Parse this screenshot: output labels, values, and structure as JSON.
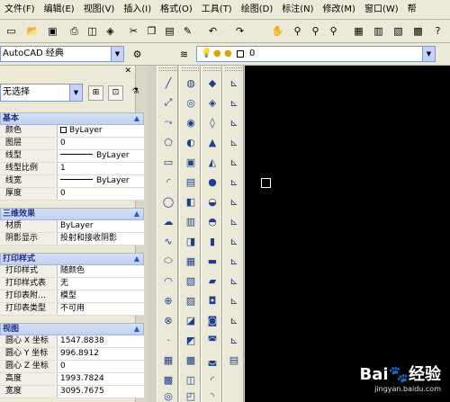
{
  "menu": {
    "items": [
      "文件(F)",
      "编辑(E)",
      "视图(V)",
      "插入(I)",
      "格式(O)",
      "工具(T)",
      "绘图(D)",
      "标注(N)",
      "修改(M)",
      "窗口(W)",
      "帮"
    ]
  },
  "toolbar": {
    "icons": [
      "new-icon",
      "open-icon",
      "save-icon",
      "plot-icon",
      "plot-preview-icon",
      "publish-icon",
      "cut-icon",
      "copy-icon",
      "paste-icon",
      "match-properties-icon",
      "undo-icon",
      "redo-icon",
      "pan-icon",
      "zoom-realtime-icon",
      "zoom-window-icon",
      "zoom-previous-icon",
      "properties-icon",
      "design-center-icon",
      "tool-palettes-icon",
      "calculator-icon"
    ]
  },
  "workspace": {
    "value": "AutoCAD 经典",
    "layer_value": "0"
  },
  "properties": {
    "selection": "无选择",
    "sections": {
      "general": "基本",
      "three_d": "三维效果",
      "plot_style": "打印样式",
      "view": "视图"
    },
    "general_rows": [
      {
        "label": "颜色",
        "value": "ByLayer"
      },
      {
        "label": "图层",
        "value": "0"
      },
      {
        "label": "线型",
        "value": "ByLayer"
      },
      {
        "label": "线型比例",
        "value": "1"
      },
      {
        "label": "线宽",
        "value": "ByLayer"
      },
      {
        "label": "厚度",
        "value": "0"
      }
    ],
    "three_d_rows": [
      {
        "label": "材质",
        "value": "ByLayer"
      },
      {
        "label": "阴影显示",
        "value": "投射和接收阴影"
      }
    ],
    "plot_rows": [
      {
        "label": "打印样式",
        "value": "随颜色"
      },
      {
        "label": "打印样式表",
        "value": "无"
      },
      {
        "label": "打印表附…",
        "value": "模型"
      },
      {
        "label": "打印表类型",
        "value": "不可用"
      }
    ],
    "view_rows": [
      {
        "label": "圆心 X 坐标",
        "value": "1547.8838"
      },
      {
        "label": "圆心 Y 坐标",
        "value": "996.8912"
      },
      {
        "label": "圆心 Z 坐标",
        "value": "0"
      },
      {
        "label": "高度",
        "value": "1993.7824"
      },
      {
        "label": "宽度",
        "value": "3095.7675"
      }
    ]
  },
  "watermark": {
    "logo": "Bai",
    "logo_cn": "经验",
    "url": "jingyan.baidu.com"
  }
}
